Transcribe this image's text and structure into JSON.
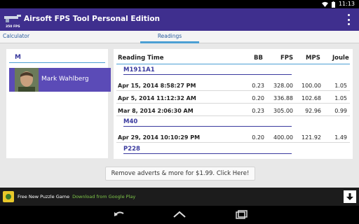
{
  "status": {
    "time": "11:13"
  },
  "app": {
    "title": "Airsoft FPS Tool Personal Edition",
    "logo_text": "350 FPS"
  },
  "tabs": [
    {
      "label": "Calculator"
    },
    {
      "label": "Readings"
    }
  ],
  "left": {
    "header": "M",
    "person": {
      "name": "Mark Wahlberg"
    }
  },
  "table": {
    "headers": {
      "time": "Reading Time",
      "bb": "BB",
      "fps": "FPS",
      "mps": "MPS",
      "joule": "Joule"
    },
    "groups": [
      {
        "name": "M1911A1",
        "rows": [
          {
            "time": "Apr 15, 2014 8:58:27 PM",
            "bb": "0.23",
            "fps": "328.00",
            "mps": "100.00",
            "joule": "1.05"
          },
          {
            "time": "Apr 5, 2014 11:12:32 AM",
            "bb": "0.20",
            "fps": "336.88",
            "mps": "102.68",
            "joule": "1.05"
          },
          {
            "time": "Mar 8, 2014 2:06:30 AM",
            "bb": "0.23",
            "fps": "305.00",
            "mps": "92.96",
            "joule": "0.99"
          }
        ]
      },
      {
        "name": "M40",
        "rows": [
          {
            "time": "Apr 29, 2014 10:10:29 PM",
            "bb": "0.20",
            "fps": "400.00",
            "mps": "121.92",
            "joule": "1.49"
          }
        ]
      },
      {
        "name": "P228",
        "rows": []
      }
    ]
  },
  "ad_button": "Remove adverts & more for $1.99. Click Here!",
  "banner": {
    "title": "Free New Puzzle Game",
    "subtitle": "Download from Google Play"
  }
}
